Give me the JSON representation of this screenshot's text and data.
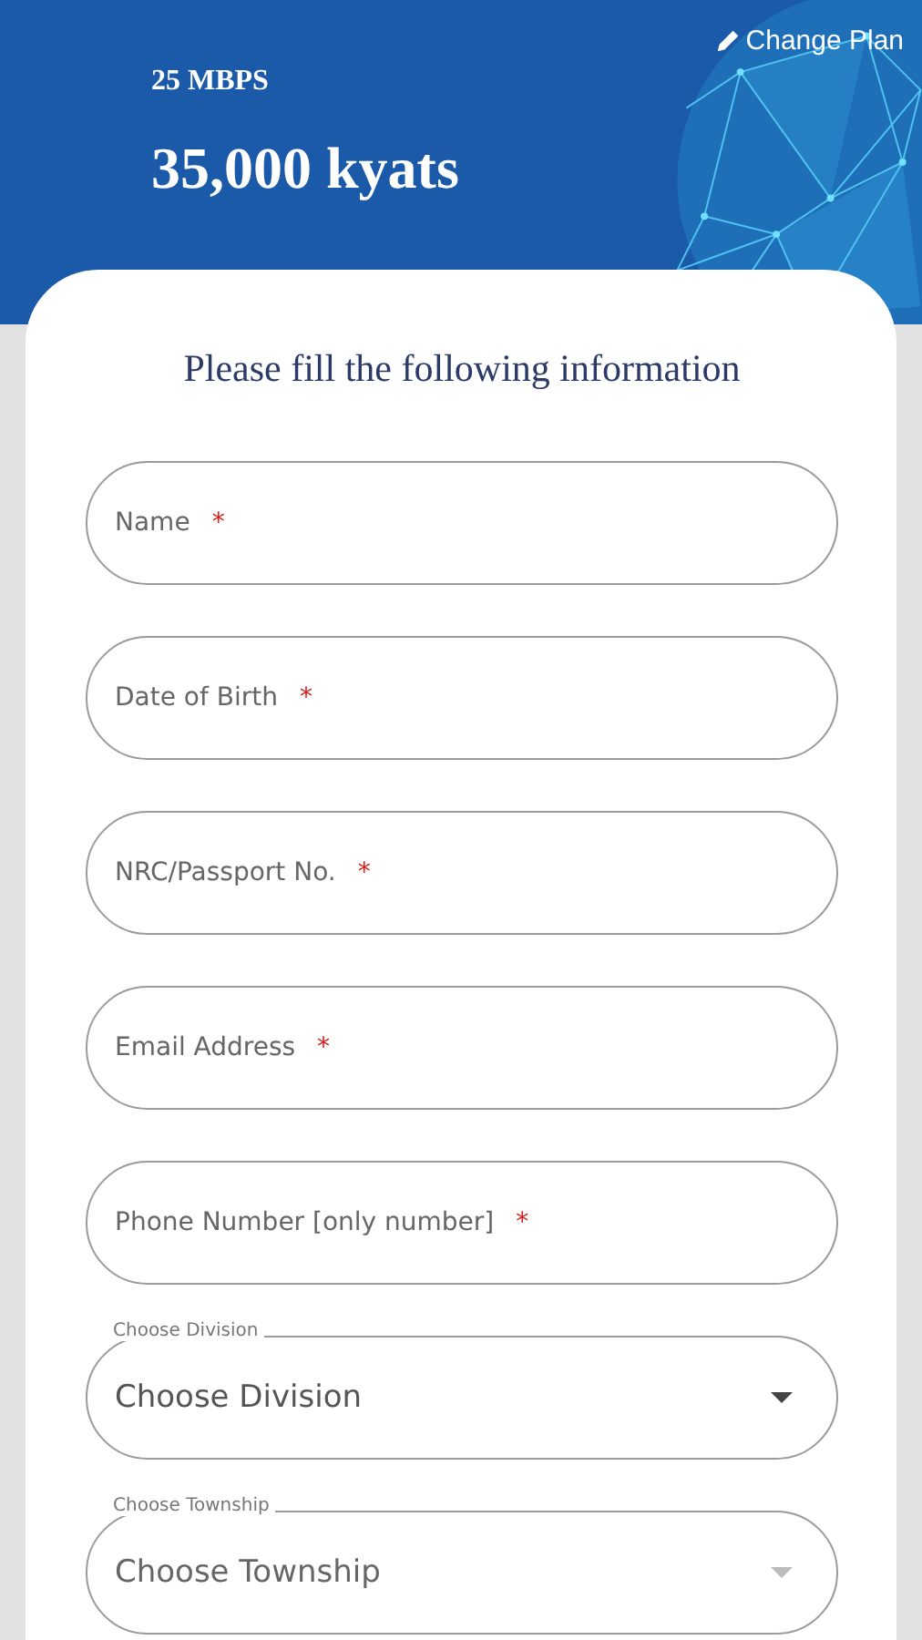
{
  "header": {
    "change_plan": "Change Plan",
    "speed": "25 MBPS",
    "price": "35,000 kyats"
  },
  "form": {
    "title": "Please fill the following information",
    "fields": [
      {
        "kind": "text",
        "placeholder": "Name",
        "required_mark": "*"
      },
      {
        "kind": "text",
        "placeholder": "Date of Birth",
        "required_mark": "*"
      },
      {
        "kind": "text",
        "placeholder": "NRC/Passport No.",
        "required_mark": "*"
      },
      {
        "kind": "text",
        "placeholder": "Email Address",
        "required_mark": "*"
      },
      {
        "kind": "text",
        "placeholder": "Phone Number [only number]",
        "required_mark": "*"
      },
      {
        "kind": "select",
        "label": "Choose Division",
        "value": "Choose Division",
        "disabled": false
      },
      {
        "kind": "select",
        "label": "Choose Township",
        "value": "Choose Township",
        "disabled": true
      }
    ]
  }
}
